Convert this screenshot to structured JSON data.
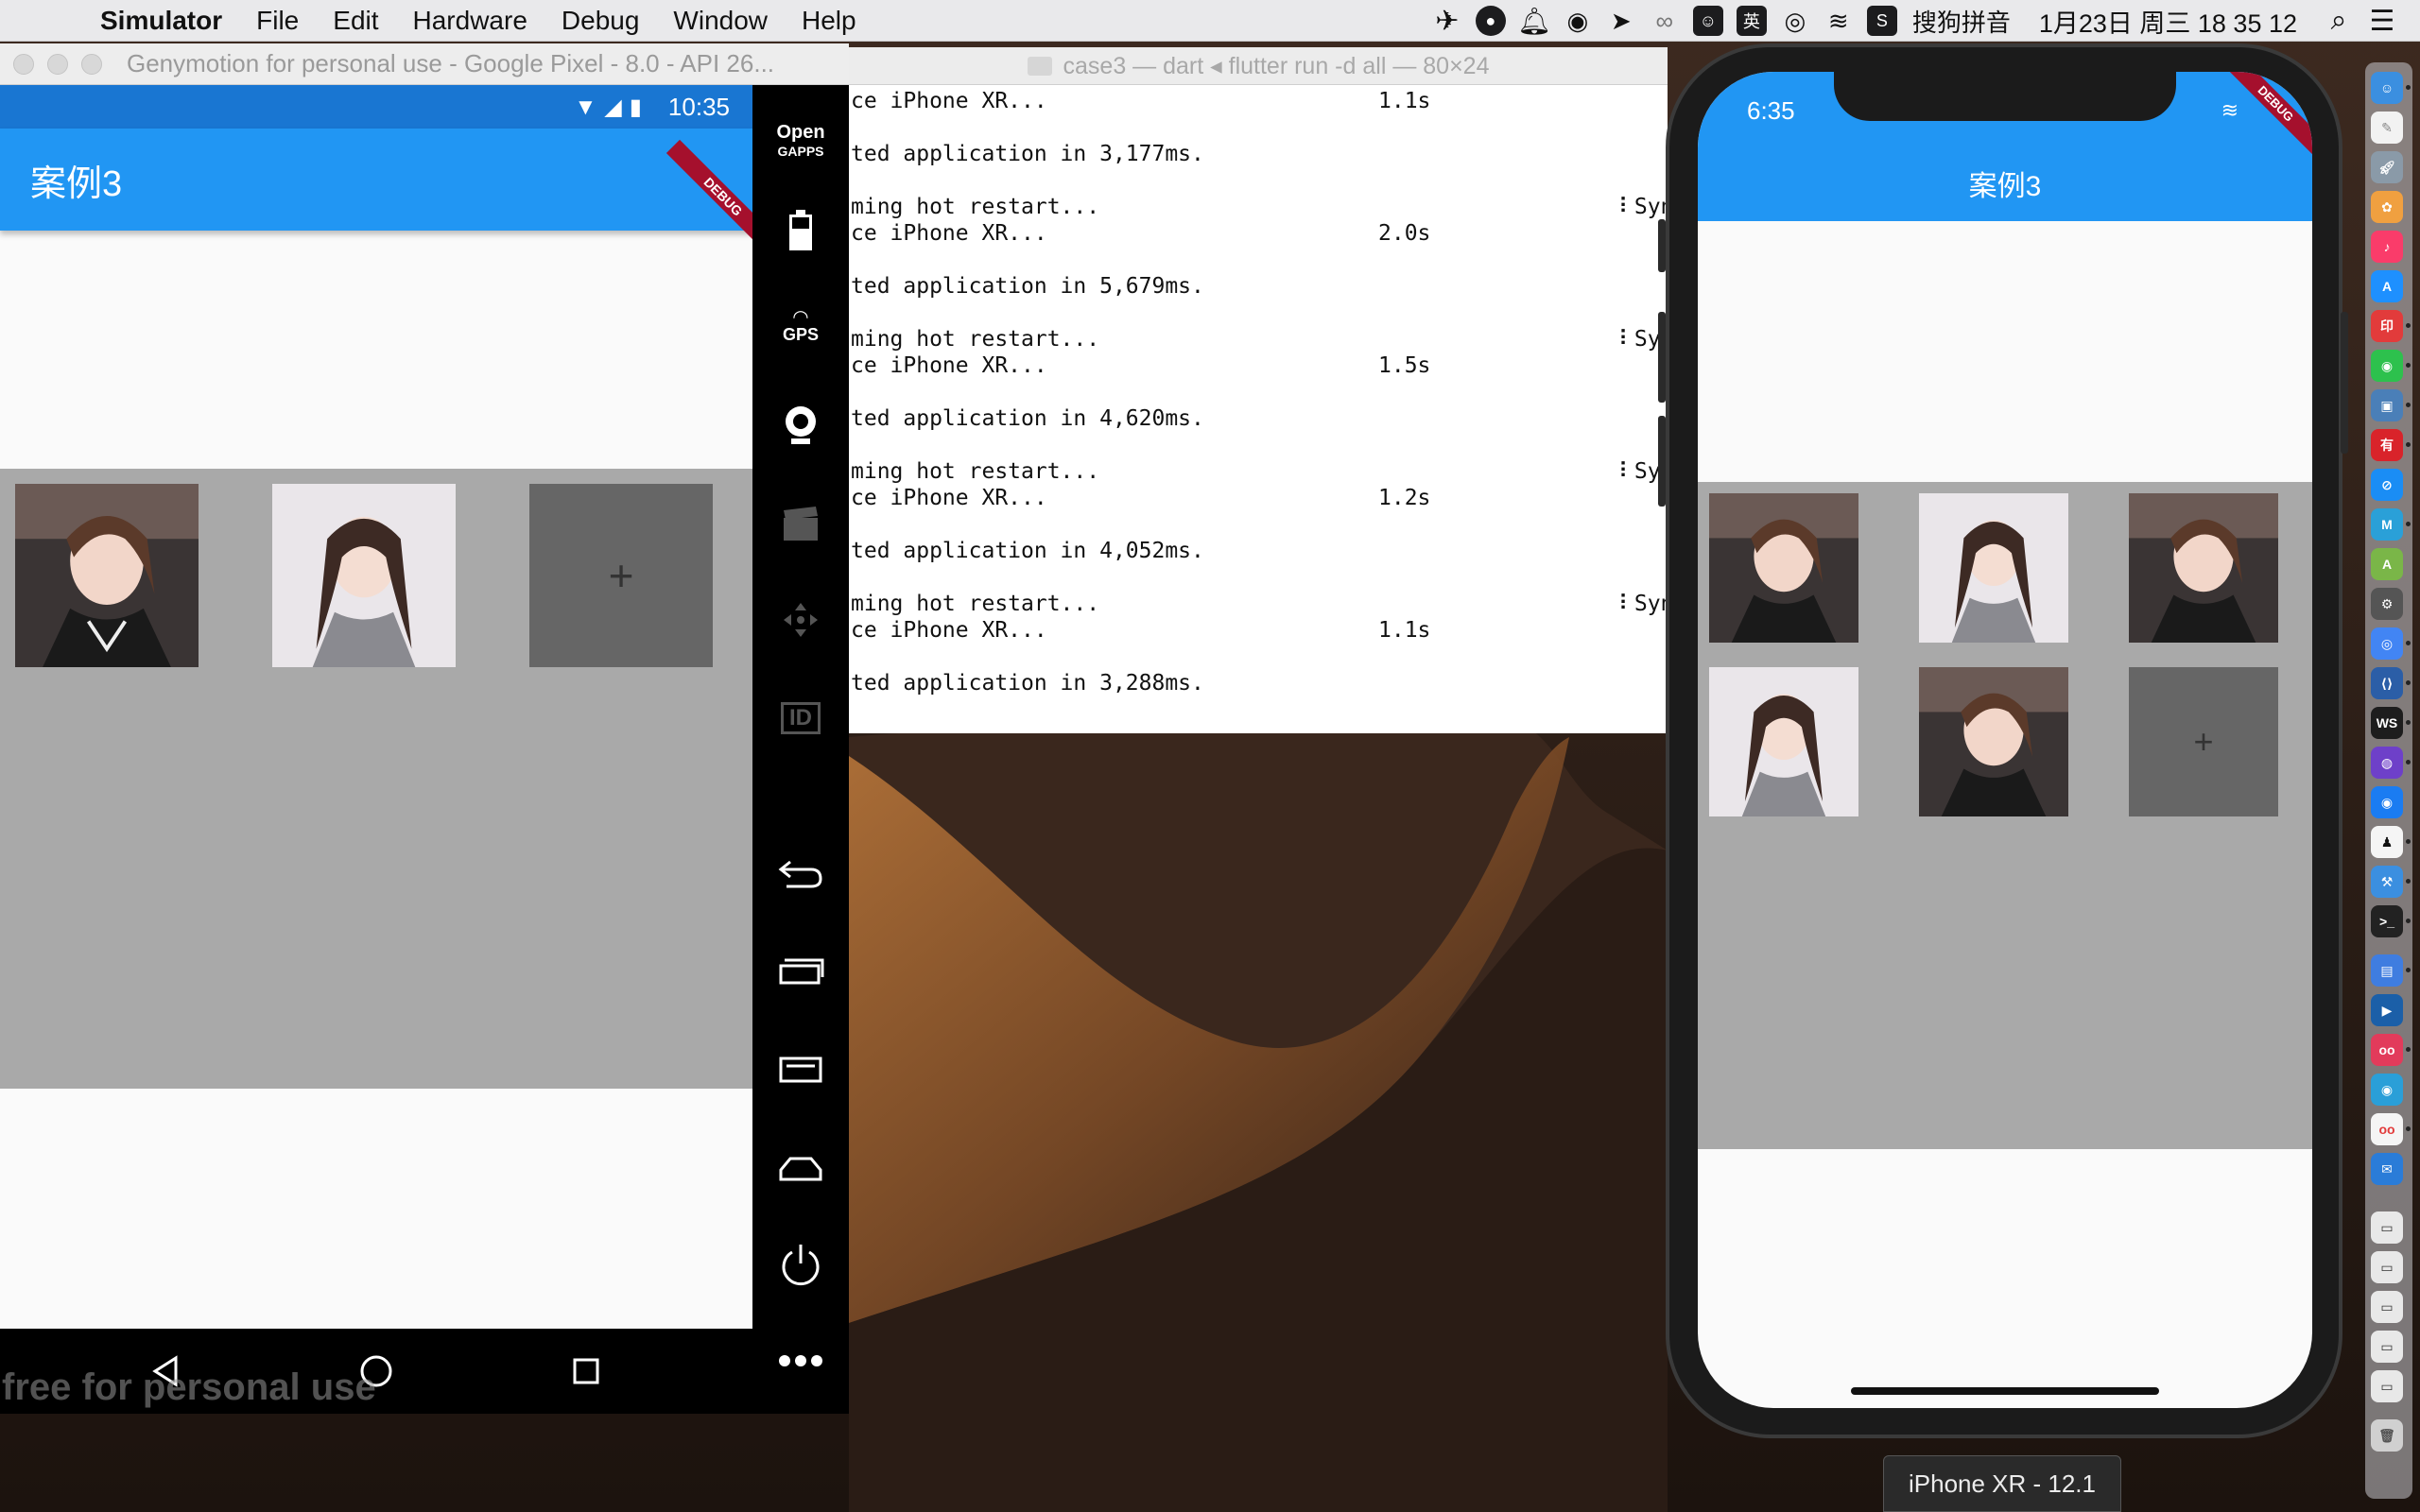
{
  "menubar": {
    "app_name": "Simulator",
    "menus": [
      "File",
      "Edit",
      "Hardware",
      "Debug",
      "Window",
      "Help"
    ],
    "ime_label": "搜狗拼音",
    "clock": "1月23日 周三  18 35 12",
    "ime_char": "英"
  },
  "genymotion": {
    "window_title": "Genymotion for personal use - Google Pixel - 8.0 - API 26...",
    "status_time": "10:35",
    "app_title": "案例3",
    "debug_label": "DEBUG",
    "add_symbol": "+",
    "watermark": "free for personal use",
    "toolbar": {
      "open_gapps_top": "Open",
      "open_gapps_bottom": "GAPPS",
      "gps": "GPS",
      "id": "ID"
    }
  },
  "terminal": {
    "window_title": "case3 — dart ◂ flutter run -d all — 80×24",
    "lines": [
      {
        "text": "ce iPhone XR...",
        "dur": "1.1s",
        "syn": ""
      },
      {
        "text": "ted application in 3,177ms.",
        "dur": "",
        "syn": ""
      },
      {
        "text": "ming hot restart...",
        "dur": "",
        "syn": "⠇Syn"
      },
      {
        "text": "ce iPhone XR...",
        "dur": "2.0s",
        "syn": ""
      },
      {
        "text": "ted application in 5,679ms.",
        "dur": "",
        "syn": ""
      },
      {
        "text": "ming hot restart...",
        "dur": "",
        "syn": "⠇Sy"
      },
      {
        "text": "ce iPhone XR...",
        "dur": "1.5s",
        "syn": ""
      },
      {
        "text": "ted application in 4,620ms.",
        "dur": "",
        "syn": ""
      },
      {
        "text": "ming hot restart...",
        "dur": "",
        "syn": "⠇Sy"
      },
      {
        "text": "ce iPhone XR...",
        "dur": "1.2s",
        "syn": ""
      },
      {
        "text": "ted application in 4,052ms.",
        "dur": "",
        "syn": ""
      },
      {
        "text": "ming hot restart...",
        "dur": "",
        "syn": "⠇Syn"
      },
      {
        "text": "ce iPhone XR...",
        "dur": "1.1s",
        "syn": ""
      },
      {
        "text": "ted application in 3,288ms.",
        "dur": "",
        "syn": ""
      }
    ]
  },
  "iphone": {
    "status_time": "6:35",
    "app_title": "案例3",
    "debug_label": "DEBUG",
    "add_symbol": "+",
    "device_label": "iPhone XR - 12.1"
  },
  "colors": {
    "app_bar": "#2196f3",
    "status_bar": "#1976d2",
    "grid_bg": "#a9a9a9",
    "add_tile": "#666666",
    "debug_ribbon": "#a5102d"
  }
}
